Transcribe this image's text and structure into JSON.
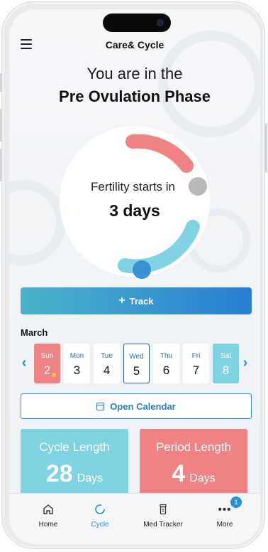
{
  "app": {
    "title": "Care& Cycle"
  },
  "phase": {
    "line1": "You are in the",
    "line2": "Pre Ovulation Phase"
  },
  "fertility": {
    "label": "Fertility starts in",
    "value": "3 days"
  },
  "track": {
    "label": "Track",
    "icon": "plus-icon"
  },
  "calendar": {
    "month": "March",
    "days": [
      {
        "name": "Sun",
        "num": "2",
        "style": "red"
      },
      {
        "name": "Mon",
        "num": "3",
        "style": "plain"
      },
      {
        "name": "Tue",
        "num": "4",
        "style": "plain"
      },
      {
        "name": "Wed",
        "num": "5",
        "style": "selected"
      },
      {
        "name": "Thu",
        "num": "6",
        "style": "plain"
      },
      {
        "name": "Fri",
        "num": "7",
        "style": "plain"
      },
      {
        "name": "Sat",
        "num": "8",
        "style": "teal"
      }
    ],
    "prev_icon": "chevron-left-icon",
    "next_icon": "chevron-right-icon"
  },
  "open_calendar": {
    "label": "Open Calendar",
    "icon": "calendar-icon"
  },
  "cards": {
    "cycle": {
      "title": "Cycle Length",
      "value": "28",
      "unit": "Days"
    },
    "period": {
      "title": "Period Length",
      "value": "4",
      "unit": "Days"
    }
  },
  "tabs": [
    {
      "label": "Home",
      "icon": "home-icon"
    },
    {
      "label": "Cycle",
      "icon": "cycle-icon"
    },
    {
      "label": "Med Tracker",
      "icon": "pill-bottle-icon"
    },
    {
      "label": "More",
      "icon": "more-dots-icon",
      "badge": "1"
    }
  ],
  "colors": {
    "period_red": "#ef8383",
    "fertile_teal": "#7fd3e3",
    "accent_blue": "#2a8fd6"
  }
}
